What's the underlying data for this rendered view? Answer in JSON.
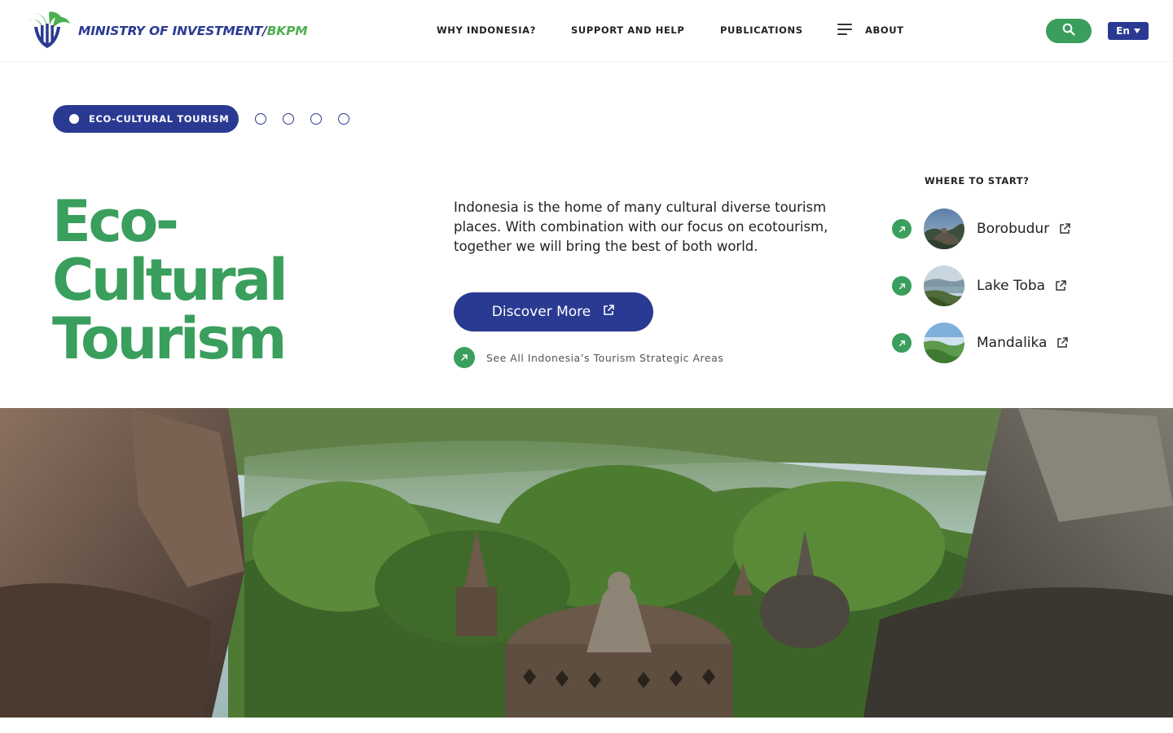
{
  "header": {
    "logo_text_main": "MINISTRY OF INVESTMENT/",
    "logo_text_accent": "BKPM",
    "logo_icon": "bkpm-logo-icon",
    "nav": [
      {
        "label": "WHY INDONESIA?"
      },
      {
        "label": "SUPPORT AND HELP"
      },
      {
        "label": "PUBLICATIONS"
      },
      {
        "label": "ABOUT"
      }
    ],
    "menu_icon": "hamburger-menu-icon",
    "search_icon": "search-icon",
    "language": "En"
  },
  "slider": {
    "active_label": "ECO-CULTURAL TOURISM",
    "total_slides": 5,
    "active_index": 1
  },
  "hero": {
    "title_lines": [
      "Eco-",
      "Cultural",
      "Tourism"
    ],
    "description": "Indonesia is the home of many cultural diverse tourism places. With  combination with our focus on ecotourism, together we will bring the best of both world.",
    "cta_label": "Discover More",
    "see_all_label": "See All Indonesia’s Tourism Strategic Areas"
  },
  "where_to_start": {
    "heading": "WHERE TO START?",
    "destinations": [
      {
        "label": "Borobudur"
      },
      {
        "label": "Lake Toba"
      },
      {
        "label": "Mandalika"
      }
    ]
  },
  "colors": {
    "primary_blue": "#2a3a92",
    "accent_green": "#3a9e5c",
    "text_dark": "#222222"
  }
}
